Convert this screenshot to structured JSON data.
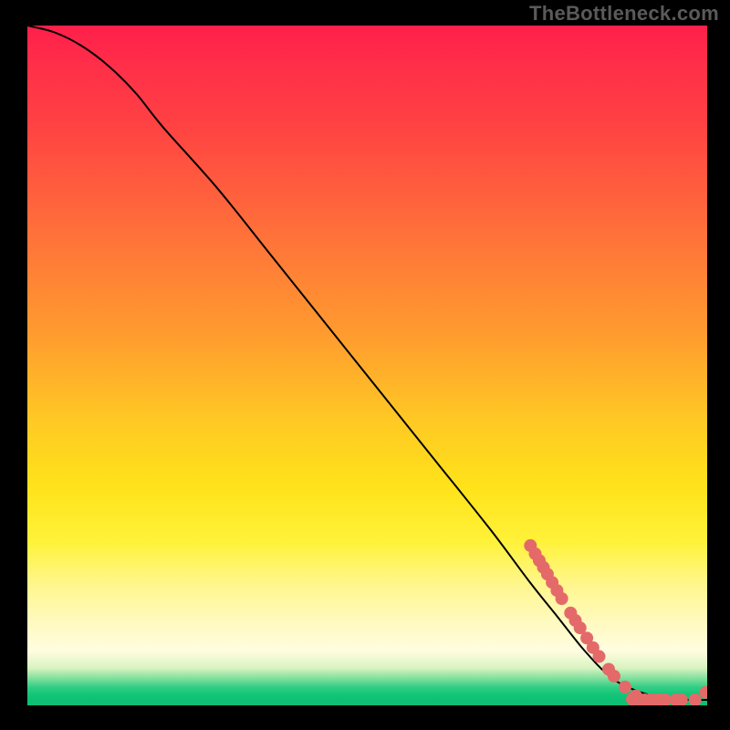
{
  "watermark": "TheBottleneck.com",
  "chart_data": {
    "type": "line",
    "title": "",
    "xlabel": "",
    "ylabel": "",
    "xlim": [
      0,
      100
    ],
    "ylim": [
      0,
      100
    ],
    "grid": false,
    "series": [
      {
        "name": "bottleneck-curve",
        "description": "Monotone decreasing curve from top-left to lower-right, flattening near the bottom; lower = better (green zone).",
        "x": [
          0,
          4,
          8,
          12,
          16,
          20,
          28,
          36,
          44,
          52,
          60,
          68,
          74,
          78,
          82,
          86,
          90,
          94,
          98,
          100
        ],
        "y": [
          100,
          99,
          97,
          94,
          90,
          85,
          76,
          66,
          56,
          46,
          36,
          26,
          18,
          13,
          8,
          4,
          2,
          1,
          0.8,
          0.8
        ]
      }
    ],
    "markers": {
      "name": "highlighted-points",
      "description": "Cluster of salmon dots along the lower part of the curve and along the near-flat tail.",
      "color": "#e46a6a",
      "points": [
        {
          "x": 74,
          "y": 23.5
        },
        {
          "x": 74.7,
          "y": 22.3
        },
        {
          "x": 75.3,
          "y": 21.3
        },
        {
          "x": 75.9,
          "y": 20.3
        },
        {
          "x": 76.5,
          "y": 19.3
        },
        {
          "x": 77.2,
          "y": 18.1
        },
        {
          "x": 77.9,
          "y": 16.9
        },
        {
          "x": 78.6,
          "y": 15.7
        },
        {
          "x": 79.9,
          "y": 13.6
        },
        {
          "x": 80.6,
          "y": 12.5
        },
        {
          "x": 81.3,
          "y": 11.4
        },
        {
          "x": 82.3,
          "y": 9.9
        },
        {
          "x": 83.2,
          "y": 8.5
        },
        {
          "x": 84.1,
          "y": 7.2
        },
        {
          "x": 85.5,
          "y": 5.3
        },
        {
          "x": 86.3,
          "y": 4.3
        },
        {
          "x": 87.9,
          "y": 2.7
        },
        {
          "x": 89.5,
          "y": 1.4
        },
        {
          "x": 89.0,
          "y": 0.9
        },
        {
          "x": 90.0,
          "y": 0.8
        },
        {
          "x": 90.8,
          "y": 0.8
        },
        {
          "x": 91.6,
          "y": 0.8
        },
        {
          "x": 92.3,
          "y": 0.8
        },
        {
          "x": 93.0,
          "y": 0.8
        },
        {
          "x": 93.8,
          "y": 0.8
        },
        {
          "x": 95.4,
          "y": 0.8
        },
        {
          "x": 96.2,
          "y": 0.8
        },
        {
          "x": 98.2,
          "y": 0.8
        },
        {
          "x": 99.8,
          "y": 1.9
        }
      ]
    },
    "color_scale": {
      "description": "Vertical background gradient encodes desirability: red (top) = bad, yellow (mid) = moderate, green (bottom) = good.",
      "stops": [
        {
          "pos": 0.0,
          "color": "#ff1f4a"
        },
        {
          "pos": 0.45,
          "color": "#ff9a2f"
        },
        {
          "pos": 0.72,
          "color": "#fff23a"
        },
        {
          "pos": 0.93,
          "color": "#d9f3c1"
        },
        {
          "pos": 0.98,
          "color": "#17c77a"
        },
        {
          "pos": 1.0,
          "color": "#0dbe73"
        }
      ]
    }
  }
}
